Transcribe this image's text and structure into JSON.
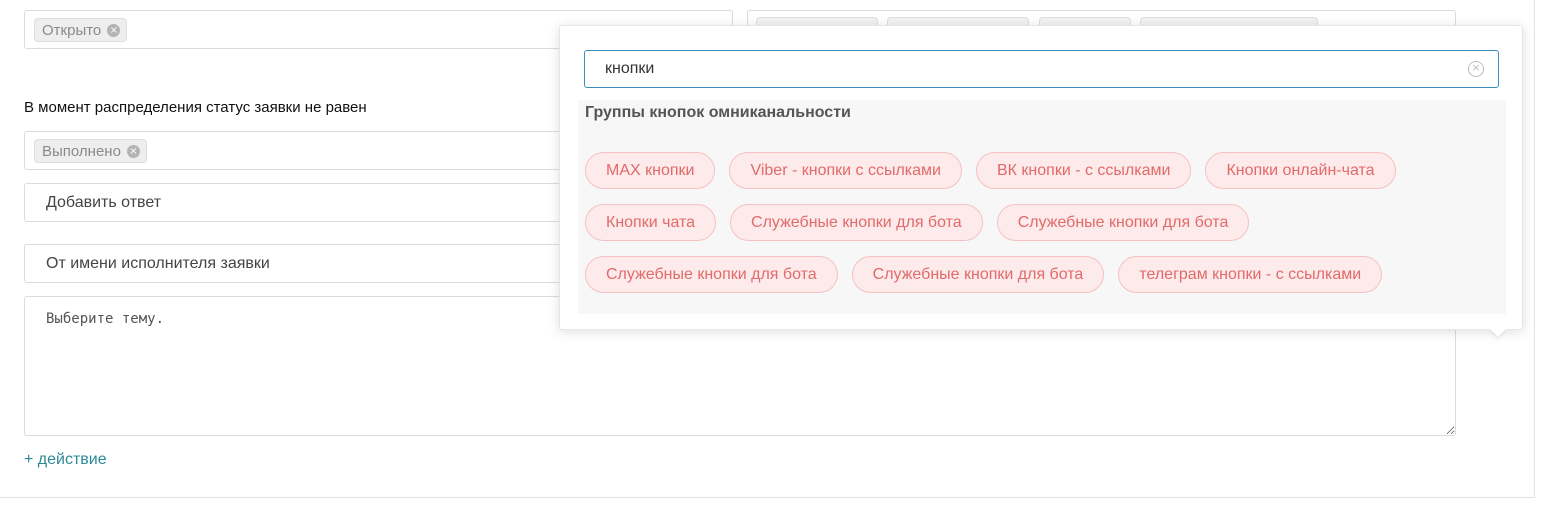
{
  "status_open_field": {
    "tags": [
      "Открыто"
    ]
  },
  "status_not_equal": {
    "label": "В момент распределения статус заявки не равен",
    "tags": [
      "Выполнено"
    ]
  },
  "add_answer_select": {
    "value": "Добавить ответ"
  },
  "author_select": {
    "value": "От имени исполнителя заявки"
  },
  "message_textarea": {
    "value": "Выберите тему."
  },
  "add_action_link": "+ действие",
  "popup": {
    "search": {
      "value": "кнопки"
    },
    "group_title": "Группы кнопок омниканальности",
    "chip_rows": [
      [
        "MAX кнопки",
        "Viber - кнопки с ссылками",
        "ВК кнопки - с ссылками",
        "Кнопки онлайн-чата"
      ],
      [
        "Кнопки чата",
        "Служебные кнопки для бота",
        "Служебные кнопки для бота"
      ],
      [
        "Служебные кнопки для бота",
        "Служебные кнопки для бота",
        "телеграм кнопки - с ссылками"
      ]
    ]
  },
  "colors": {
    "chip_text": "#e26a6a",
    "chip_bg": "#fdeaea",
    "chip_border": "#f6c1c1",
    "search_focus_border": "#3c8dbc",
    "link": "#2b8a99"
  }
}
